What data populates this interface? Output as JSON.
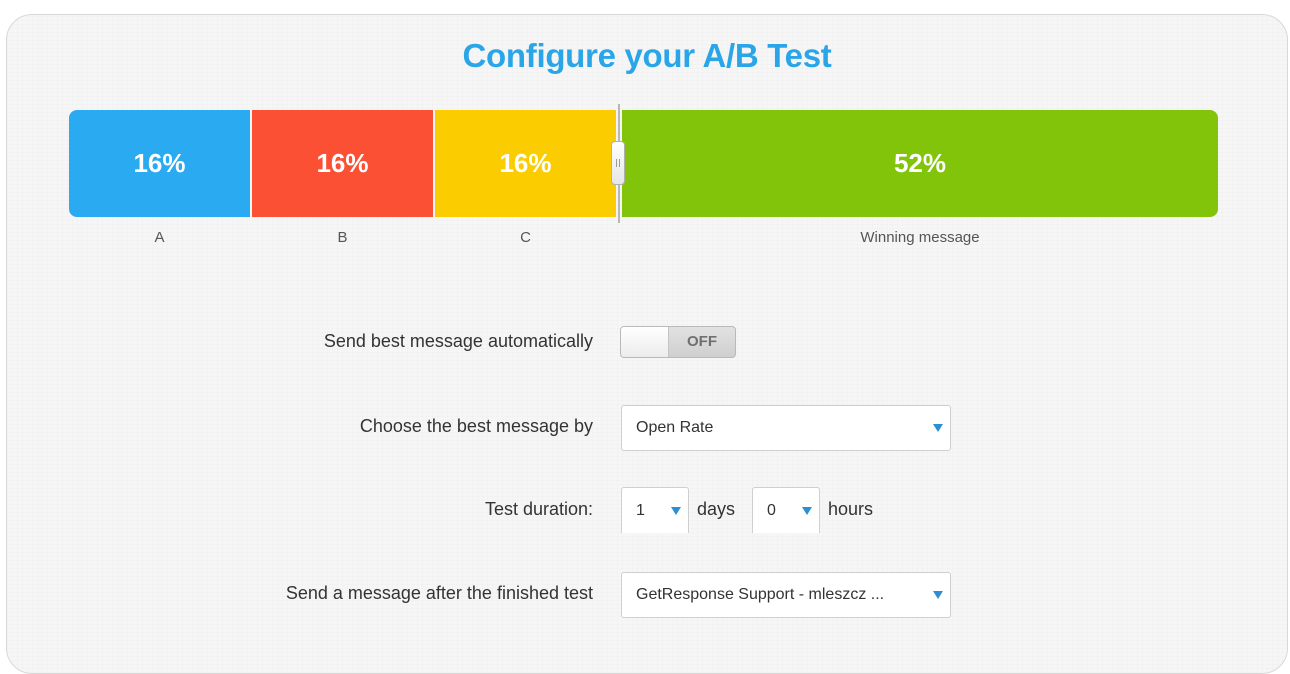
{
  "title": "Configure your A/B Test",
  "split": {
    "segments": [
      {
        "label": "A",
        "percent_text": "16%",
        "percent": 16,
        "color": "#2aaaf0"
      },
      {
        "label": "B",
        "percent_text": "16%",
        "percent": 16,
        "color": "#fb5034"
      },
      {
        "label": "C",
        "percent_text": "16%",
        "percent": 16,
        "color": "#fbcd00"
      },
      {
        "label": "Winning message",
        "percent_text": "52%",
        "percent": 52,
        "color": "#82c40a"
      }
    ]
  },
  "form": {
    "auto_send": {
      "label": "Send best message automatically",
      "state": "OFF"
    },
    "best_by": {
      "label": "Choose the best message by",
      "value": "Open Rate"
    },
    "duration": {
      "label": "Test duration:",
      "days_value": "1",
      "days_unit": "days",
      "hours_value": "0",
      "hours_unit": "hours"
    },
    "after_test": {
      "label": "Send a message after the finished test",
      "value": "GetResponse Support - mleszcz ..."
    }
  },
  "colors": {
    "title": "#2aa6e8",
    "caret": "#2a8fd4"
  },
  "icons": {
    "split_handle": "drag-handle-icon",
    "select_caret": "triangle-down-icon"
  }
}
